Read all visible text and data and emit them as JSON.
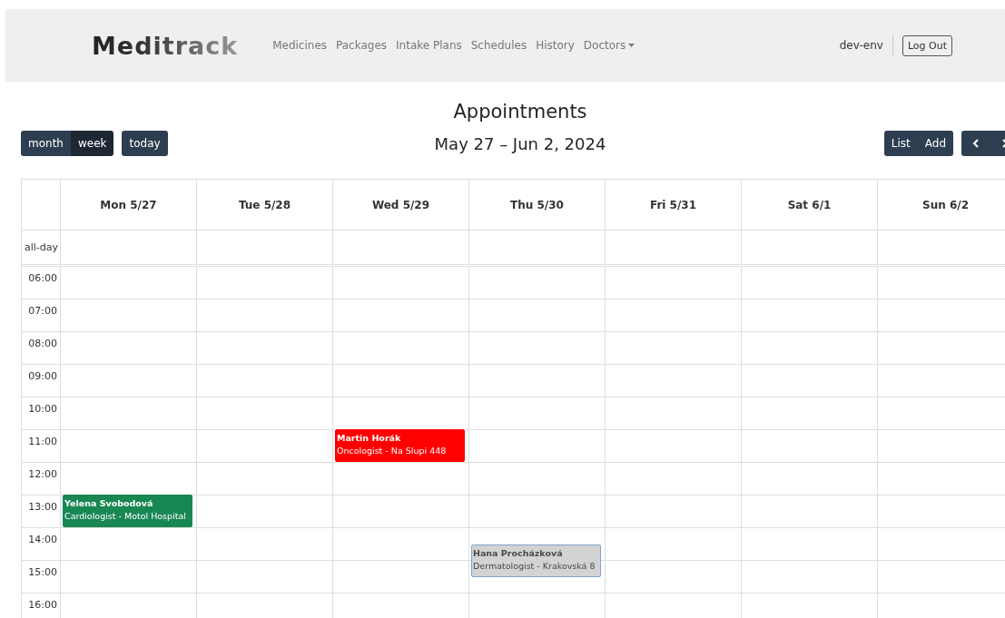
{
  "navbar": {
    "logo": "Meditrack",
    "links": [
      {
        "label": "Medicines",
        "dropdown": false
      },
      {
        "label": "Packages",
        "dropdown": false
      },
      {
        "label": "Intake Plans",
        "dropdown": false
      },
      {
        "label": "Schedules",
        "dropdown": false
      },
      {
        "label": "History",
        "dropdown": false
      },
      {
        "label": "Doctors",
        "dropdown": true
      }
    ],
    "user": "dev-env",
    "logout": "Log Out"
  },
  "title": "Appointments",
  "toolbar": {
    "views": [
      {
        "label": "month",
        "selected": false
      },
      {
        "label": "week",
        "selected": true
      }
    ],
    "today": "today",
    "range": "May 27 – Jun 2, 2024",
    "actions": [
      "List",
      "Add"
    ]
  },
  "calendar": {
    "all_day_label": "all-day",
    "days": [
      "Mon 5/27",
      "Tue 5/28",
      "Wed 5/29",
      "Thu 5/30",
      "Fri 5/31",
      "Sat 6/1",
      "Sun 6/2"
    ],
    "times": [
      {
        "label": "06:00"
      },
      {
        "label": "07:00"
      },
      {
        "label": "08:00"
      },
      {
        "label": "09:00"
      },
      {
        "label": "10:00"
      },
      {
        "label": "11:00",
        "cells": [
          null,
          null,
          {
            "kind": "hour",
            "title": "Martin Horák",
            "detail": "Oncologist - Na Slupi 448",
            "color": "#ff0000"
          },
          null,
          null,
          null,
          null
        ]
      },
      {
        "label": "12:00"
      },
      {
        "label": "13:00",
        "cells": [
          {
            "kind": "hour",
            "title": "Yelena Svobodová",
            "detail": "Cardiologist - Motol Hospital",
            "color": "#198754"
          },
          null,
          null,
          null,
          null,
          null,
          null
        ]
      },
      {
        "label": "14:00",
        "cells": [
          null,
          null,
          null,
          {
            "kind": "halfhour",
            "title": "Hana Procházková",
            "detail": "Dermatologist - Krakovská 8",
            "color": "#d3d3d3"
          },
          null,
          null,
          null
        ]
      },
      {
        "label": "15:00"
      },
      {
        "label": "16:00"
      }
    ]
  }
}
